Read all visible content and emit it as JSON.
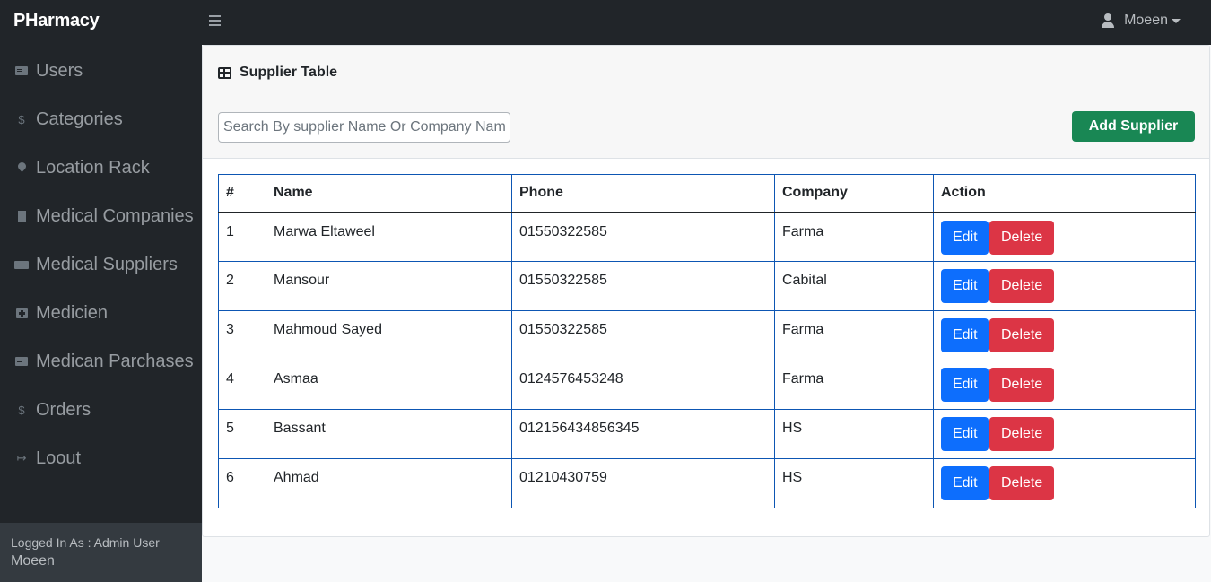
{
  "topbar": {
    "brand_initial": "P",
    "brand_rest": "Harmacy",
    "user_name": "Moeen"
  },
  "sidebar": {
    "items": [
      {
        "label": "Users",
        "icon": "id-card-icon"
      },
      {
        "label": "Categories",
        "icon": "dollar-icon"
      },
      {
        "label": "Location Rack",
        "icon": "map-pin-icon"
      },
      {
        "label": "Medical Companies",
        "icon": "building-icon"
      },
      {
        "label": "Medical Suppliers",
        "icon": "truck-icon"
      },
      {
        "label": "Medicien",
        "icon": "medkit-icon"
      },
      {
        "label": "Medican Parchases",
        "icon": "id-card-icon"
      },
      {
        "label": "Orders",
        "icon": "dollar-icon"
      },
      {
        "label": "Loout",
        "icon": "logout-icon"
      }
    ],
    "footer_label": "Logged In As : Admin User",
    "footer_name": "Moeen"
  },
  "main": {
    "title": "Supplier Table",
    "search_placeholder": "Search By supplier Name Or Company Name",
    "add_button": "Add Supplier"
  },
  "table": {
    "headers": [
      "#",
      "Name",
      "Phone",
      "Company",
      "Action"
    ],
    "edit_label": "Edit",
    "delete_label": "Delete",
    "rows": [
      {
        "num": "1",
        "name": "Marwa Eltaweel",
        "phone": "01550322585",
        "company": "Farma"
      },
      {
        "num": "2",
        "name": "Mansour",
        "phone": "01550322585",
        "company": "Cabital"
      },
      {
        "num": "3",
        "name": "Mahmoud Sayed",
        "phone": "01550322585",
        "company": "Farma"
      },
      {
        "num": "4",
        "name": "Asmaa",
        "phone": "0124576453248",
        "company": "Farma"
      },
      {
        "num": "5",
        "name": "Bassant",
        "phone": "012156434856345",
        "company": "HS"
      },
      {
        "num": "6",
        "name": "Ahmad",
        "phone": "01210430759",
        "company": "HS"
      }
    ]
  }
}
